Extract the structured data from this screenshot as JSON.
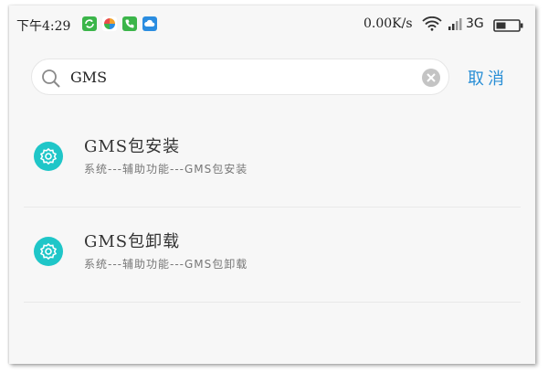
{
  "status_bar": {
    "time": "下午4:29",
    "app_icons": [
      {
        "name": "refresh-app-icon",
        "color": "#3bb54a"
      },
      {
        "name": "pinwheel-app-icon",
        "color": "#f2a02c"
      },
      {
        "name": "phone-app-icon",
        "color": "#3bb54a"
      },
      {
        "name": "cloud-app-icon",
        "color": "#2b8de0"
      }
    ],
    "net_speed": "0.00K/s",
    "network": "3G"
  },
  "search": {
    "query": "GMS",
    "cancel_label": "取消"
  },
  "results": [
    {
      "title": "GMS包安装",
      "path": "系统---辅助功能---GMS包安装"
    },
    {
      "title": "GMS包卸载",
      "path": "系统---辅助功能---GMS包卸载"
    }
  ],
  "colors": {
    "accent": "#2a8fd6",
    "result_icon": "#1fc6c8"
  }
}
